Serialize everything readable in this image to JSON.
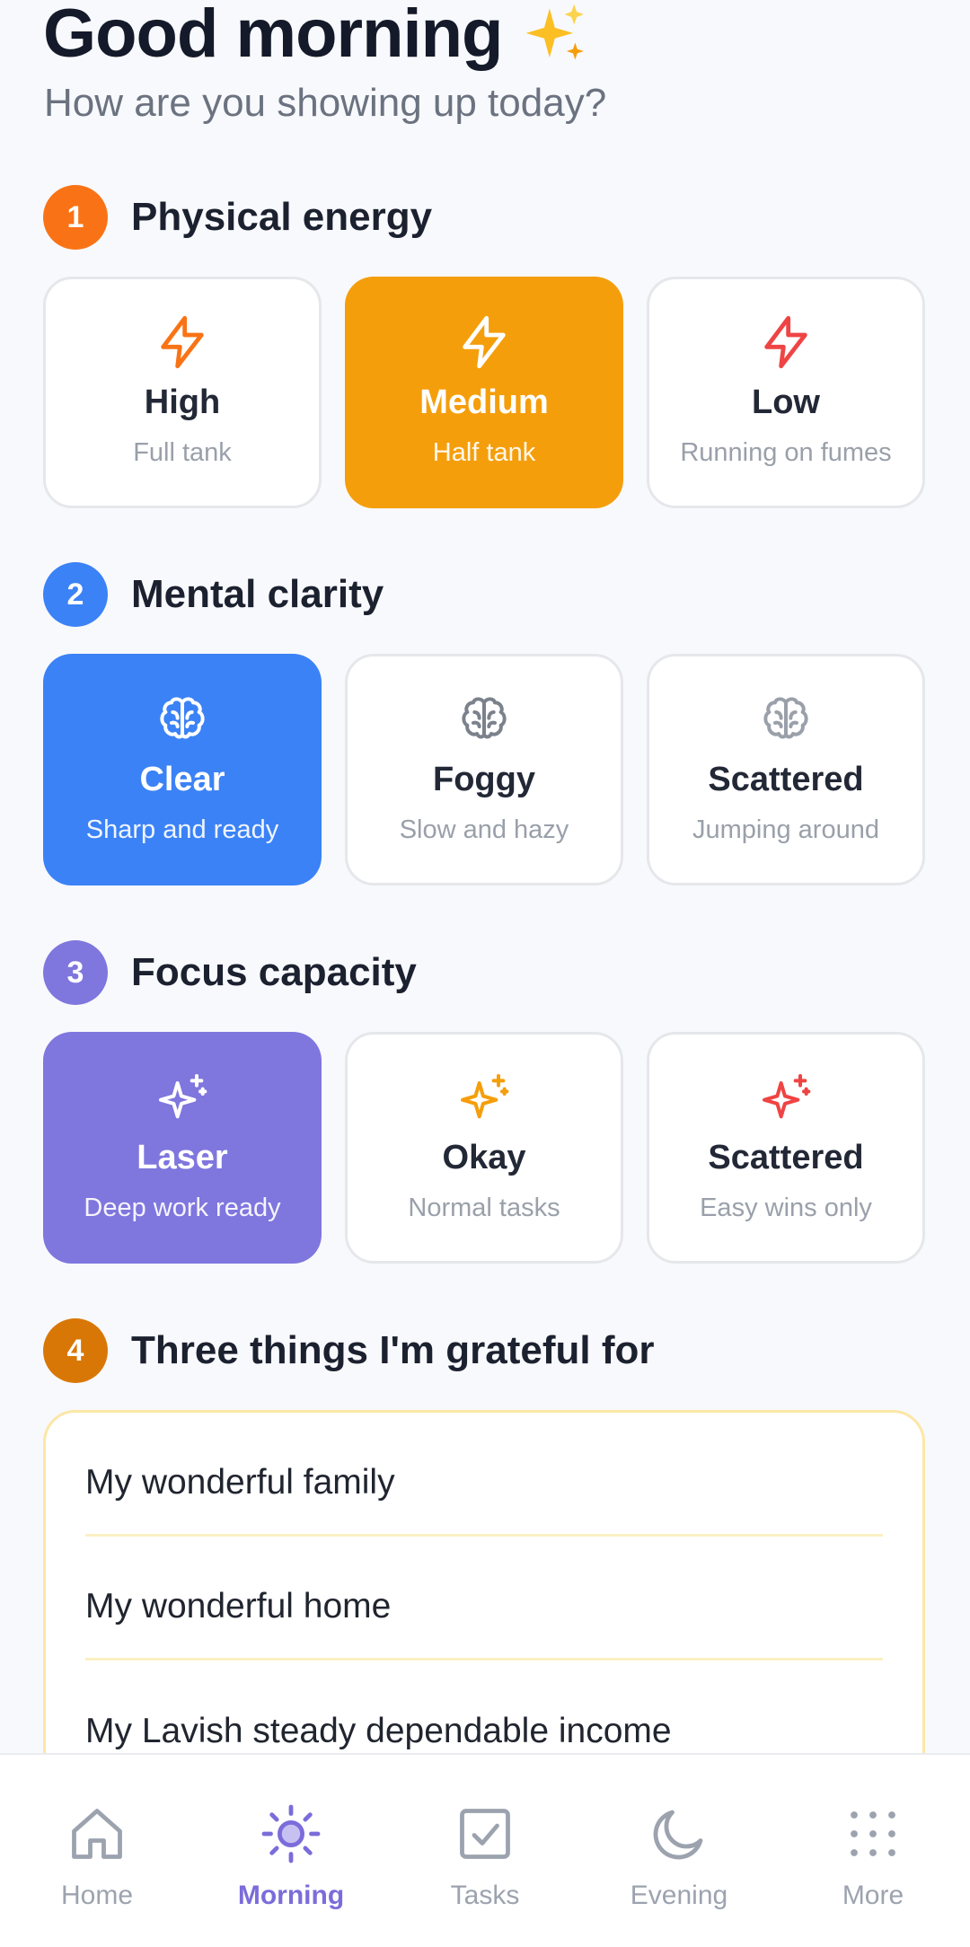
{
  "header": {
    "title": "Good morning",
    "subtitle": "How are you showing up today?"
  },
  "colors": {
    "orange": "#f97316",
    "amber": "#f59e0b",
    "red": "#ef4444",
    "blue": "#3b82f6",
    "purple": "#7f76de",
    "gold": "#d97706",
    "gray_icon": "#8b929c"
  },
  "sections": [
    {
      "number": "1",
      "title": "Physical energy",
      "options": [
        {
          "label": "High",
          "desc": "Full tank",
          "icon": "lightning-icon",
          "selected": false
        },
        {
          "label": "Medium",
          "desc": "Half tank",
          "icon": "lightning-icon",
          "selected": true
        },
        {
          "label": "Low",
          "desc": "Running on fumes",
          "icon": "lightning-icon",
          "selected": false
        }
      ]
    },
    {
      "number": "2",
      "title": "Mental clarity",
      "options": [
        {
          "label": "Clear",
          "desc": "Sharp and ready",
          "icon": "brain-icon",
          "selected": true
        },
        {
          "label": "Foggy",
          "desc": "Slow and hazy",
          "icon": "brain-icon",
          "selected": false
        },
        {
          "label": "Scattered",
          "desc": "Jumping around",
          "icon": "brain-icon",
          "selected": false
        }
      ]
    },
    {
      "number": "3",
      "title": "Focus capacity",
      "options": [
        {
          "label": "Laser",
          "desc": "Deep work ready",
          "icon": "sparkle-icon",
          "selected": true
        },
        {
          "label": "Okay",
          "desc": "Normal tasks",
          "icon": "sparkle-icon",
          "selected": false
        },
        {
          "label": "Scattered",
          "desc": "Easy wins only",
          "icon": "sparkle-icon",
          "selected": false
        }
      ]
    },
    {
      "number": "4",
      "title": "Three things I'm grateful for",
      "items": [
        "My wonderful family",
        "My wonderful home",
        "My Lavish steady dependable income"
      ]
    }
  ],
  "nav": [
    {
      "label": "Home",
      "icon": "home-icon",
      "active": false
    },
    {
      "label": "Morning",
      "icon": "sun-icon",
      "active": true
    },
    {
      "label": "Tasks",
      "icon": "checkbox-icon",
      "active": false
    },
    {
      "label": "Evening",
      "icon": "moon-icon",
      "active": false
    },
    {
      "label": "More",
      "icon": "grid-dots-icon",
      "active": false
    }
  ]
}
